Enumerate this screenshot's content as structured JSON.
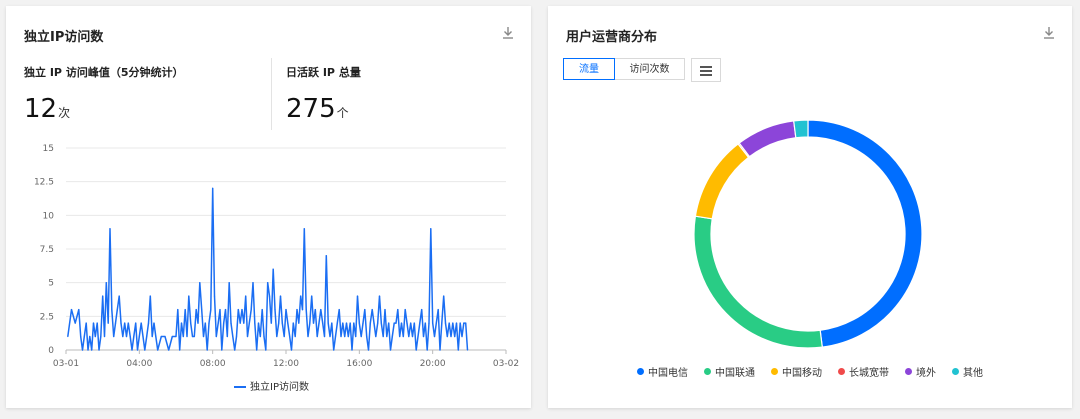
{
  "left_panel": {
    "title": "独立IP访问数",
    "peak_label": "独立 IP 访问峰值（5分钟统计）",
    "peak_value": "12",
    "peak_unit": "次",
    "active_label": "日活跃 IP 总量",
    "active_value": "275",
    "active_unit": "个",
    "download_icon": "download-icon"
  },
  "right_panel": {
    "title": "用户运营商分布",
    "tabs": [
      "流量",
      "访问次数"
    ],
    "active_tab": "流量",
    "menu_icon": "menu-icon",
    "download_icon": "download-icon"
  },
  "chart_data": [
    {
      "type": "line",
      "x_tick_labels": [
        "03-01",
        "04:00",
        "08:00",
        "12:00",
        "16:00",
        "20:00",
        "03-02"
      ],
      "y_ticks": [
        "0",
        "2.5",
        "5",
        "7.5",
        "10",
        "12.5",
        "15"
      ],
      "ylim": [
        0,
        15
      ],
      "x_unit": "hours",
      "xlim": [
        0,
        24
      ],
      "grid": true,
      "legend_position": "bottom-center",
      "series": [
        {
          "name": "独立IP访问数",
          "color": "#1b6ef3",
          "points": [
            [
              0.1,
              1
            ],
            [
              0.3,
              3
            ],
            [
              0.5,
              2
            ],
            [
              0.7,
              3
            ],
            [
              0.8,
              1
            ],
            [
              0.9,
              0
            ],
            [
              1.0,
              1
            ],
            [
              1.1,
              2
            ],
            [
              1.2,
              0
            ],
            [
              1.3,
              1
            ],
            [
              1.4,
              0
            ],
            [
              1.5,
              2
            ],
            [
              1.6,
              1
            ],
            [
              1.7,
              2
            ],
            [
              1.8,
              0
            ],
            [
              1.9,
              1
            ],
            [
              2.0,
              4
            ],
            [
              2.1,
              1
            ],
            [
              2.2,
              5
            ],
            [
              2.3,
              2
            ],
            [
              2.4,
              9
            ],
            [
              2.5,
              3
            ],
            [
              2.6,
              1
            ],
            [
              2.7,
              2
            ],
            [
              2.8,
              3
            ],
            [
              2.9,
              4
            ],
            [
              3.0,
              2
            ],
            [
              3.1,
              1
            ],
            [
              3.2,
              2
            ],
            [
              3.3,
              1
            ],
            [
              3.4,
              2
            ],
            [
              3.5,
              1
            ],
            [
              3.6,
              0
            ],
            [
              3.7,
              1
            ],
            [
              3.8,
              2
            ],
            [
              3.9,
              0
            ],
            [
              4.0,
              1
            ],
            [
              4.1,
              2
            ],
            [
              4.2,
              1
            ],
            [
              4.3,
              0
            ],
            [
              4.4,
              1
            ],
            [
              4.5,
              2
            ],
            [
              4.6,
              4
            ],
            [
              4.7,
              1
            ],
            [
              4.8,
              2
            ],
            [
              4.9,
              1
            ],
            [
              5.0,
              0
            ],
            [
              5.2,
              1
            ],
            [
              5.4,
              1
            ],
            [
              5.6,
              0
            ],
            [
              5.8,
              1
            ],
            [
              6.0,
              1
            ],
            [
              6.1,
              3
            ],
            [
              6.2,
              0
            ],
            [
              6.3,
              2
            ],
            [
              6.4,
              1
            ],
            [
              6.5,
              3
            ],
            [
              6.6,
              1
            ],
            [
              6.7,
              4
            ],
            [
              6.8,
              2
            ],
            [
              6.9,
              1
            ],
            [
              7.0,
              1
            ],
            [
              7.1,
              3
            ],
            [
              7.2,
              2
            ],
            [
              7.3,
              5
            ],
            [
              7.4,
              3
            ],
            [
              7.5,
              1
            ],
            [
              7.6,
              2
            ],
            [
              7.7,
              0
            ],
            [
              7.8,
              2
            ],
            [
              7.9,
              3
            ],
            [
              8.0,
              12
            ],
            [
              8.1,
              4
            ],
            [
              8.2,
              1
            ],
            [
              8.3,
              2
            ],
            [
              8.4,
              3
            ],
            [
              8.5,
              0
            ],
            [
              8.6,
              2
            ],
            [
              8.7,
              3
            ],
            [
              8.8,
              1
            ],
            [
              8.9,
              5
            ],
            [
              9.0,
              2
            ],
            [
              9.1,
              1
            ],
            [
              9.2,
              0
            ],
            [
              9.3,
              1
            ],
            [
              9.4,
              3
            ],
            [
              9.5,
              2
            ],
            [
              9.6,
              3
            ],
            [
              9.7,
              2
            ],
            [
              9.8,
              4
            ],
            [
              9.9,
              1
            ],
            [
              10.0,
              2
            ],
            [
              10.1,
              3
            ],
            [
              10.2,
              5
            ],
            [
              10.3,
              2
            ],
            [
              10.4,
              0
            ],
            [
              10.5,
              2
            ],
            [
              10.6,
              1
            ],
            [
              10.7,
              3
            ],
            [
              10.8,
              1
            ],
            [
              10.9,
              0
            ],
            [
              11.0,
              5
            ],
            [
              11.1,
              4
            ],
            [
              11.2,
              2
            ],
            [
              11.3,
              6
            ],
            [
              11.4,
              3
            ],
            [
              11.5,
              1
            ],
            [
              11.6,
              2
            ],
            [
              11.7,
              4
            ],
            [
              11.8,
              2
            ],
            [
              11.9,
              1
            ],
            [
              12.0,
              3
            ],
            [
              12.1,
              2
            ],
            [
              12.2,
              1
            ],
            [
              12.3,
              0
            ],
            [
              12.4,
              2
            ],
            [
              12.5,
              1
            ],
            [
              12.6,
              3
            ],
            [
              12.7,
              2
            ],
            [
              12.8,
              4
            ],
            [
              12.9,
              3
            ],
            [
              13.0,
              9
            ],
            [
              13.1,
              3
            ],
            [
              13.2,
              1
            ],
            [
              13.3,
              2
            ],
            [
              13.4,
              4
            ],
            [
              13.5,
              2
            ],
            [
              13.6,
              3
            ],
            [
              13.7,
              1
            ],
            [
              13.8,
              2
            ],
            [
              13.9,
              3
            ],
            [
              14.0,
              2
            ],
            [
              14.1,
              1
            ],
            [
              14.2,
              7
            ],
            [
              14.3,
              2
            ],
            [
              14.4,
              1
            ],
            [
              14.5,
              2
            ],
            [
              14.6,
              0
            ],
            [
              14.7,
              1
            ],
            [
              14.8,
              2
            ],
            [
              14.9,
              3
            ],
            [
              15.0,
              1
            ],
            [
              15.1,
              2
            ],
            [
              15.2,
              1
            ],
            [
              15.3,
              2
            ],
            [
              15.4,
              1
            ],
            [
              15.5,
              2
            ],
            [
              15.6,
              0
            ],
            [
              15.7,
              2
            ],
            [
              15.8,
              1
            ],
            [
              15.9,
              4
            ],
            [
              16.0,
              2
            ],
            [
              16.1,
              1
            ],
            [
              16.2,
              2
            ],
            [
              16.3,
              3
            ],
            [
              16.4,
              1
            ],
            [
              16.5,
              0
            ],
            [
              16.6,
              2
            ],
            [
              16.7,
              3
            ],
            [
              16.8,
              2
            ],
            [
              16.9,
              1
            ],
            [
              17.0,
              2
            ],
            [
              17.1,
              4
            ],
            [
              17.2,
              2
            ],
            [
              17.3,
              1
            ],
            [
              17.4,
              3
            ],
            [
              17.5,
              1
            ],
            [
              17.6,
              2
            ],
            [
              17.7,
              0
            ],
            [
              17.8,
              1
            ],
            [
              17.9,
              2
            ],
            [
              18.0,
              2
            ],
            [
              18.1,
              3
            ],
            [
              18.2,
              1
            ],
            [
              18.3,
              2
            ],
            [
              18.4,
              1
            ],
            [
              18.5,
              3
            ],
            [
              18.6,
              2
            ],
            [
              18.7,
              1
            ],
            [
              18.8,
              2
            ],
            [
              18.9,
              1
            ],
            [
              19.0,
              2
            ],
            [
              19.1,
              0
            ],
            [
              19.2,
              1
            ],
            [
              19.3,
              2
            ],
            [
              19.4,
              3
            ],
            [
              19.5,
              1
            ],
            [
              19.6,
              2
            ],
            [
              19.7,
              0
            ],
            [
              19.8,
              2
            ],
            [
              19.9,
              9
            ],
            [
              20.0,
              2
            ],
            [
              20.1,
              1
            ],
            [
              20.2,
              2
            ],
            [
              20.3,
              3
            ],
            [
              20.4,
              0
            ],
            [
              20.5,
              2
            ],
            [
              20.6,
              4
            ],
            [
              20.7,
              2
            ],
            [
              20.8,
              1
            ],
            [
              20.9,
              2
            ],
            [
              21.0,
              1
            ],
            [
              21.1,
              2
            ],
            [
              21.2,
              1
            ],
            [
              21.3,
              2
            ],
            [
              21.4,
              0
            ],
            [
              21.5,
              2
            ],
            [
              21.6,
              1
            ],
            [
              21.7,
              2
            ],
            [
              21.8,
              2
            ],
            [
              21.9,
              0
            ]
          ]
        }
      ]
    },
    {
      "type": "pie",
      "style": "donut",
      "legend_position": "bottom-center",
      "series": [
        {
          "name": "中国电信",
          "value": 48,
          "color": "#006eff"
        },
        {
          "name": "中国联通",
          "value": 29.5,
          "color": "#29cc85"
        },
        {
          "name": "中国移动",
          "value": 12,
          "color": "#ffbb00"
        },
        {
          "name": "长城宽带",
          "value": 0.2,
          "color": "#f04a4a"
        },
        {
          "name": "境外",
          "value": 8.3,
          "color": "#8c45d9"
        },
        {
          "name": "其他",
          "value": 2,
          "color": "#21c2d1"
        }
      ]
    }
  ]
}
